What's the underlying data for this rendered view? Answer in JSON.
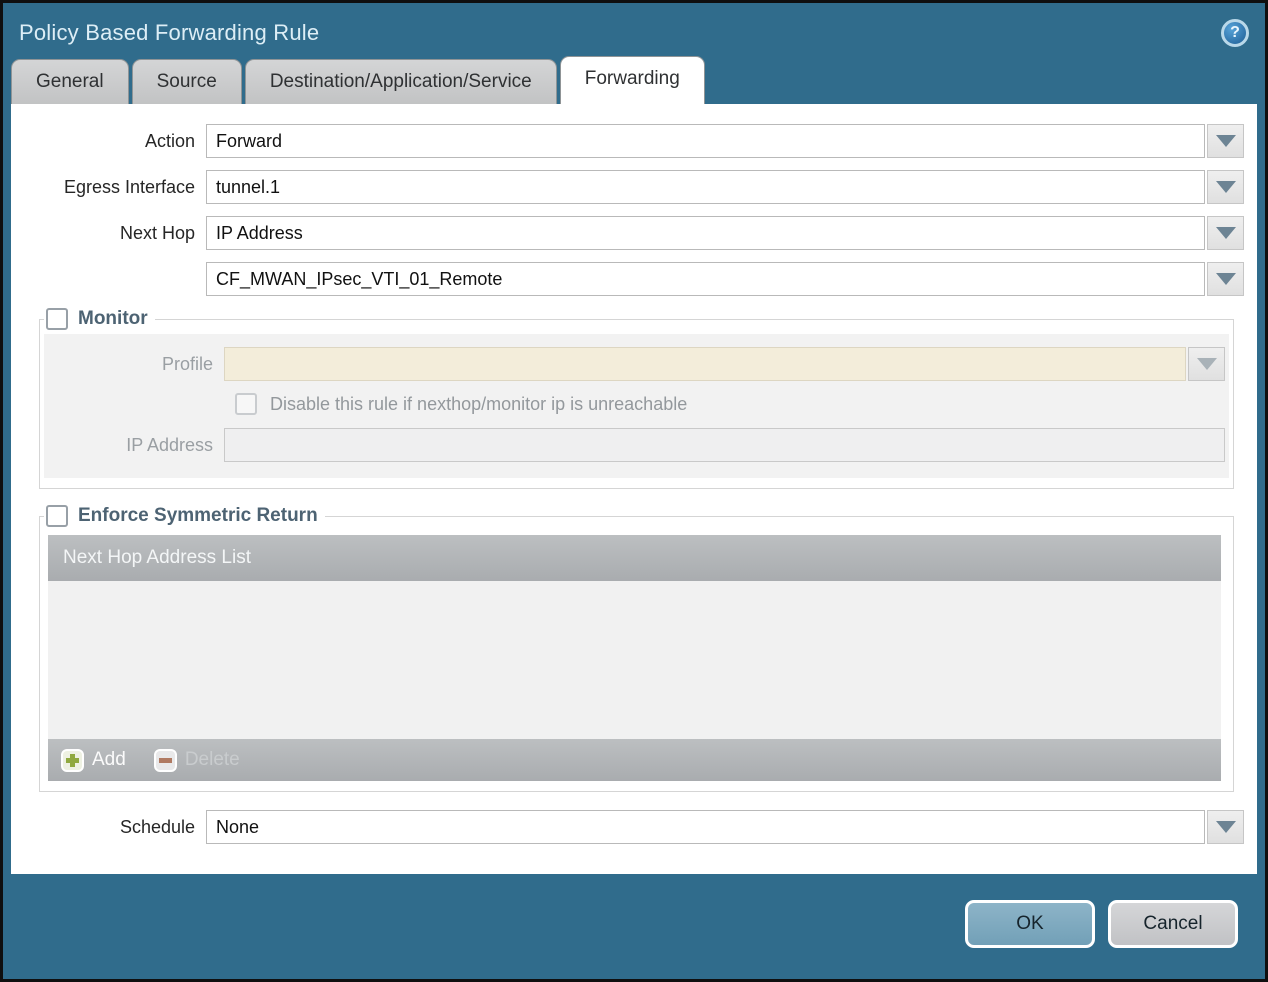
{
  "window": {
    "title": "Policy Based Forwarding Rule",
    "help_glyph": "?"
  },
  "tabs": [
    {
      "label": "General",
      "active": false
    },
    {
      "label": "Source",
      "active": false
    },
    {
      "label": "Destination/Application/Service",
      "active": false
    },
    {
      "label": "Forwarding",
      "active": true
    }
  ],
  "form": {
    "action": {
      "label": "Action",
      "value": "Forward"
    },
    "egress_interface": {
      "label": "Egress Interface",
      "value": "tunnel.1"
    },
    "next_hop": {
      "label": "Next Hop",
      "value": "IP Address"
    },
    "next_hop_address": {
      "value": "CF_MWAN_IPsec_VTI_01_Remote"
    },
    "schedule": {
      "label": "Schedule",
      "value": "None"
    }
  },
  "monitor": {
    "label": "Monitor",
    "checked": false,
    "profile": {
      "label": "Profile",
      "value": ""
    },
    "disable_rule": {
      "label": "Disable this rule if nexthop/monitor ip is unreachable",
      "checked": false
    },
    "ip_address": {
      "label": "IP Address",
      "value": ""
    }
  },
  "enforce_symmetric_return": {
    "label": "Enforce Symmetric Return",
    "checked": false,
    "table": {
      "header": "Next Hop Address List",
      "rows": []
    },
    "add_label": "Add",
    "delete_label": "Delete"
  },
  "footer": {
    "ok_label": "OK",
    "cancel_label": "Cancel"
  },
  "colors": {
    "chrome_teal": "#306c8c",
    "active_tab_bg": "#ffffff",
    "inactive_tab_bg": "#c6c7c8",
    "disabled_field_cream": "#f3edda",
    "table_chrome_gray": "#aeb1b4",
    "legend_slate": "#4d6373",
    "ok_button_bg": "#7fa9bf",
    "cancel_button_bg": "#cbccce",
    "add_icon_green": "#90a93f",
    "delete_icon_red": "#b07a62"
  }
}
